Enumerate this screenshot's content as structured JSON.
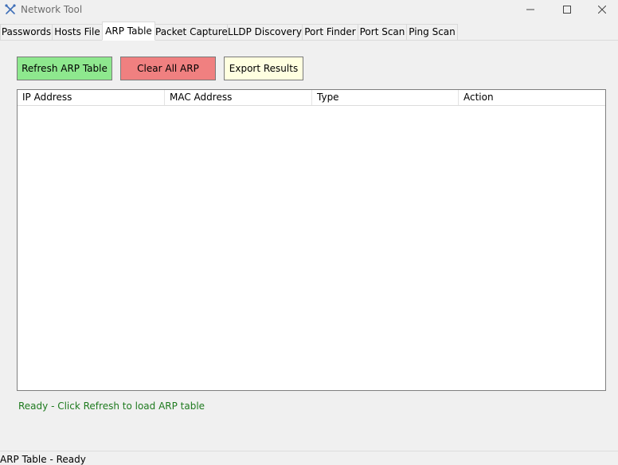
{
  "window": {
    "title": "Network Tool",
    "app_icon": "crossed-tools-icon",
    "controls": [
      "minimize-icon",
      "maximize-icon",
      "close-icon"
    ]
  },
  "tabs": [
    {
      "label": "Passwords",
      "active": false
    },
    {
      "label": "Hosts File",
      "active": false
    },
    {
      "label": "ARP Table",
      "active": true
    },
    {
      "label": "Packet Capture",
      "active": false
    },
    {
      "label": "LLDP Discovery",
      "active": false
    },
    {
      "label": "Port Finder",
      "active": false
    },
    {
      "label": "Port Scan",
      "active": false
    },
    {
      "label": "Ping Scan",
      "active": false
    }
  ],
  "toolbar": {
    "refresh_label": "Refresh ARP Table",
    "clear_label": "Clear All ARP",
    "export_label": "Export Results"
  },
  "colors": {
    "refresh_bg": "#8ee88e",
    "clear_bg": "#f08080",
    "export_bg": "#ffffe0",
    "status_text": "#1e7a1e"
  },
  "table": {
    "columns": [
      "IP Address",
      "MAC Address",
      "Type",
      "Action"
    ],
    "rows": []
  },
  "status_message": "Ready - Click Refresh to load ARP table",
  "statusbar_text": "ARP Table - Ready"
}
